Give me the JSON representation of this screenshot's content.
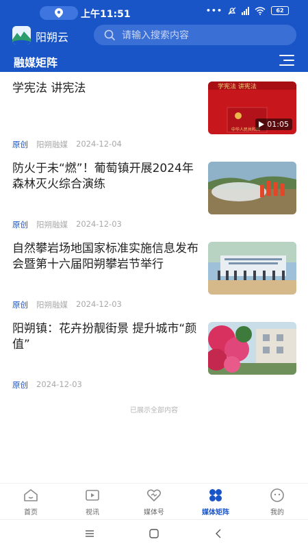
{
  "status": {
    "time": "上午11:51",
    "battery": "62",
    "network": "4G"
  },
  "app": {
    "name": "阳朔云",
    "search_placeholder": "请输入搜索内容",
    "page_title": "融媒矩阵"
  },
  "colors": {
    "brand": "#1a55c8",
    "tag": "#1a55c8",
    "meta": "#a8a8a8"
  },
  "articles": [
    {
      "title": "学宪法 讲宪法",
      "tag": "原创",
      "source": "阳朔融媒",
      "date": "2024-12-04",
      "duration": "01:05",
      "has_thumb": true
    },
    {
      "title": "防火于未“燃”！葡萄镇开展2024年森林灭火综合演练",
      "tag": "原创",
      "source": "阳朔融媒",
      "date": "2024-12-03",
      "has_thumb": true
    },
    {
      "title": "自然攀岩场地国家标准实施信息发布会暨第十六届阳朔攀岩节举行",
      "tag": "原创",
      "source": "阳朔融媒",
      "date": "2024-12-03",
      "has_thumb": true
    },
    {
      "title": "阳朔镇：花卉扮靓街景 提升城市“颜值”",
      "tag": "原创",
      "source": "",
      "date": "2024-12-03",
      "has_thumb": true
    }
  ],
  "end_note": "已展示全部内容",
  "tabs": [
    {
      "label": "首页",
      "icon": "home-icon",
      "active": false
    },
    {
      "label": "视讯",
      "icon": "video-icon",
      "active": false
    },
    {
      "label": "媒体号",
      "icon": "media-icon",
      "active": false
    },
    {
      "label": "媒体矩阵",
      "icon": "matrix-icon",
      "active": true
    },
    {
      "label": "我的",
      "icon": "profile-icon",
      "active": false
    }
  ]
}
